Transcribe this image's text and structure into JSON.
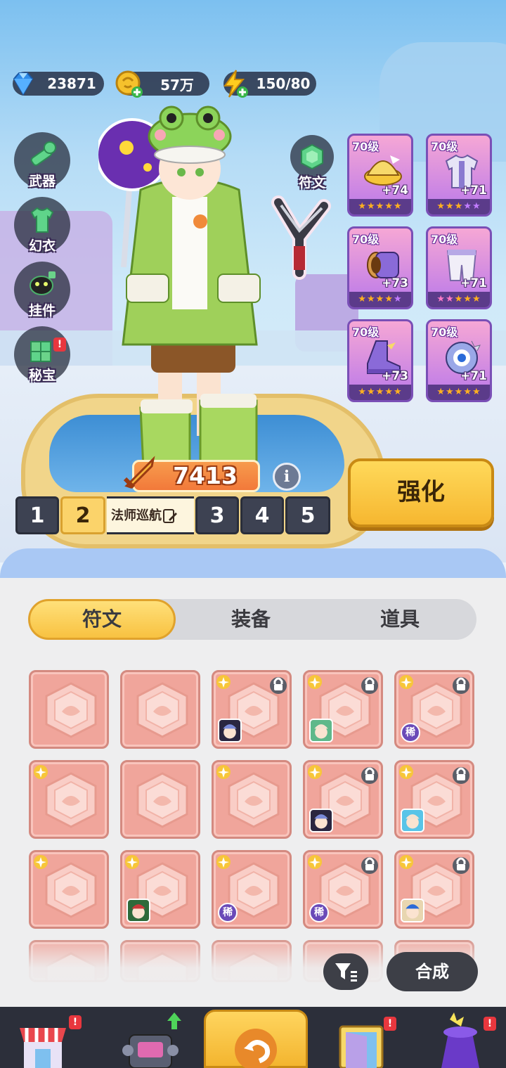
{
  "currency": {
    "gems": "23871",
    "gold": "57万",
    "energy": "150/80"
  },
  "side_menu": [
    {
      "label": "武器",
      "icon": "weapon-icon",
      "alert": false
    },
    {
      "label": "幻衣",
      "icon": "outfit-icon",
      "alert": false
    },
    {
      "label": "挂件",
      "icon": "pendant-icon",
      "alert": false
    },
    {
      "label": "秘宝",
      "icon": "treasure-icon",
      "alert": true
    }
  ],
  "alert_mark": "!",
  "rune_shortcut": {
    "label": "符文"
  },
  "equipment": [
    {
      "level": "70级",
      "plus": "+74",
      "item": "hat"
    },
    {
      "level": "70级",
      "plus": "+71",
      "item": "jacket"
    },
    {
      "level": "70级",
      "plus": "+73",
      "item": "bracer"
    },
    {
      "level": "70级",
      "plus": "+71",
      "item": "pants"
    },
    {
      "level": "70级",
      "plus": "+73",
      "item": "boots"
    },
    {
      "level": "70级",
      "plus": "+71",
      "item": "orb"
    }
  ],
  "power": "7413",
  "info_label": "i",
  "enhance_label": "强化",
  "presets": {
    "slots": [
      "1",
      "2",
      "3",
      "4",
      "5"
    ],
    "active_index": 1,
    "active_name": "法师巡航"
  },
  "tabs": [
    {
      "label": "符文",
      "active": true
    },
    {
      "label": "装备",
      "active": false
    },
    {
      "label": "道具",
      "active": false
    }
  ],
  "runes": [
    {
      "spark": false,
      "lock": false,
      "badge": null
    },
    {
      "spark": false,
      "lock": false,
      "badge": null
    },
    {
      "spark": true,
      "lock": true,
      "badge": "avatar-dark"
    },
    {
      "spark": true,
      "lock": true,
      "badge": "avatar-green"
    },
    {
      "spark": true,
      "lock": true,
      "badge": "rare"
    },
    {
      "spark": true,
      "lock": false,
      "badge": null
    },
    {
      "spark": false,
      "lock": false,
      "badge": null
    },
    {
      "spark": true,
      "lock": false,
      "badge": null
    },
    {
      "spark": true,
      "lock": true,
      "badge": "avatar-dark"
    },
    {
      "spark": true,
      "lock": true,
      "badge": "avatar-blue"
    },
    {
      "spark": true,
      "lock": false,
      "badge": null
    },
    {
      "spark": true,
      "lock": false,
      "badge": "avatar-hood"
    },
    {
      "spark": true,
      "lock": false,
      "badge": "rare"
    },
    {
      "spark": true,
      "lock": true,
      "badge": "rare"
    },
    {
      "spark": true,
      "lock": true,
      "badge": "avatar-hat"
    }
  ],
  "rare_label": "稀",
  "compose_label": "合成",
  "colors": {
    "accent_yellow": "#f8c241",
    "rune_bg": "#f0a59b",
    "equip_purple": "#b978ea",
    "alert_red": "#e8373e"
  },
  "bottom_nav": [
    {
      "icon": "shop-icon",
      "alert": true
    },
    {
      "icon": "robot-icon",
      "upgrade": true
    },
    {
      "icon": "return-icon",
      "active": true
    },
    {
      "icon": "portal-icon",
      "alert": true
    },
    {
      "icon": "magic-hat-icon",
      "alert": true
    }
  ]
}
